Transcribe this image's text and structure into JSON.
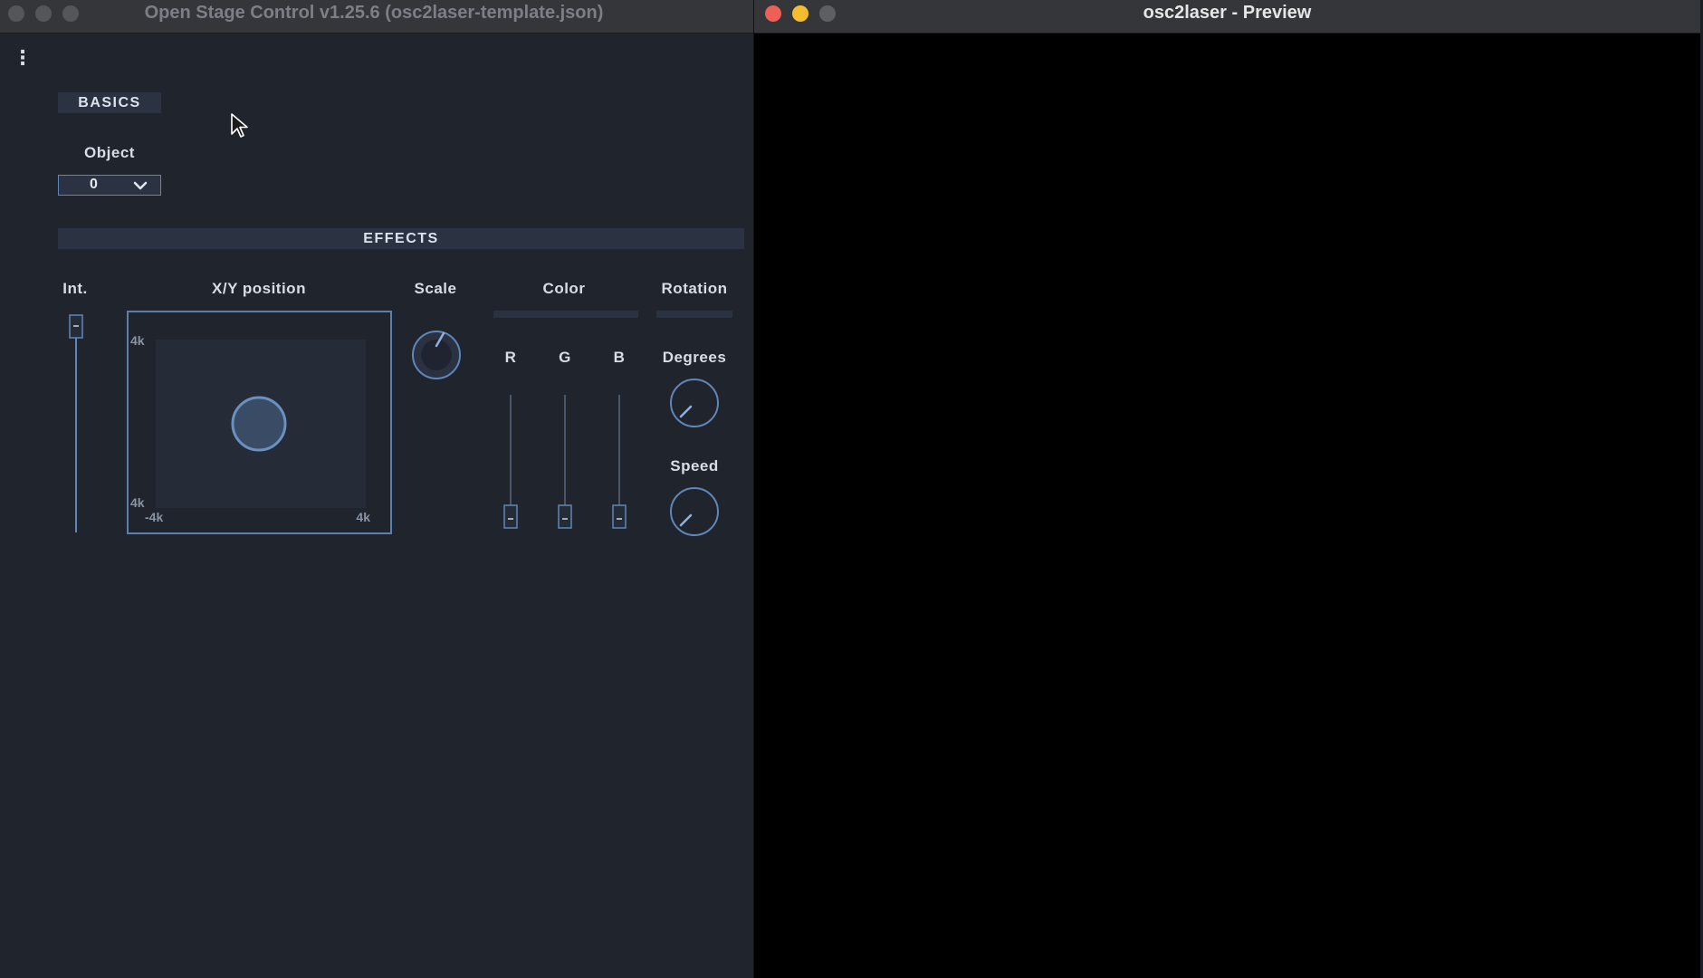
{
  "osc_window": {
    "title": "Open Stage Control v1.25.6 (osc2laser-template.json)",
    "menu_icon": "vertical-dots",
    "basics": {
      "header": "BASICS",
      "object_label": "Object",
      "object_value": "0"
    },
    "effects": {
      "header": "EFFECTS",
      "intensity": {
        "label": "Int."
      },
      "xy_position": {
        "label": "X/Y position",
        "y_max_label": "4k",
        "y_min_label": "4k",
        "x_min_label": "-4k",
        "x_max_label": "4k"
      },
      "scale": {
        "label": "Scale"
      },
      "color": {
        "label": "Color",
        "channels": [
          {
            "name": "R"
          },
          {
            "name": "G"
          },
          {
            "name": "B"
          }
        ]
      },
      "rotation": {
        "label": "Rotation",
        "degrees_label": "Degrees",
        "speed_label": "Speed"
      }
    }
  },
  "preview_window": {
    "title": "osc2laser - Preview"
  },
  "colors": {
    "accent": "#5f86b8",
    "panel_bg": "#20242c",
    "header_bg": "#2b3343",
    "preview_bg": "#000000",
    "close": "#ee5f57",
    "minimize": "#f4bd2f",
    "inactive_light": "#5d5f63"
  }
}
